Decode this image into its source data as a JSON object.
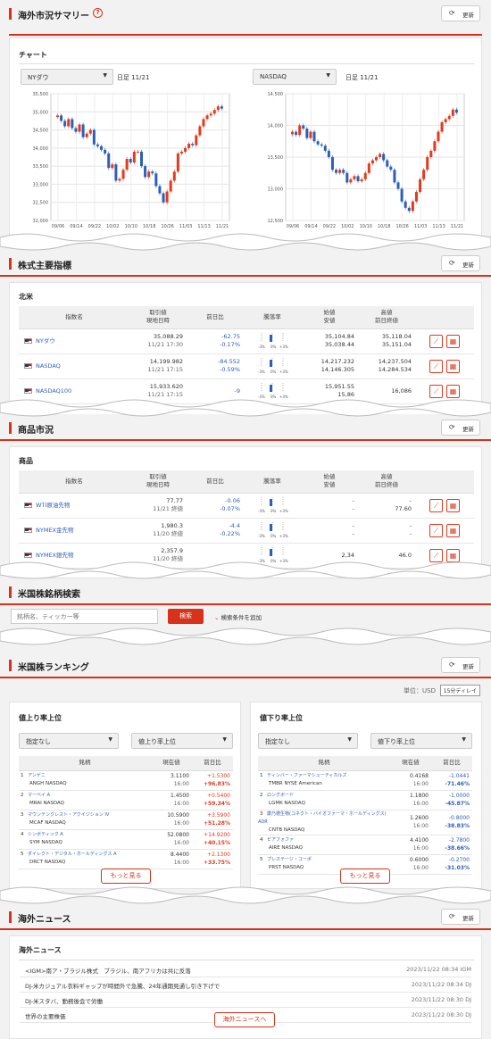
{
  "summary": {
    "title": "海外市況サマリー",
    "refresh": "更新",
    "chart_heading": "チャート",
    "charts": [
      {
        "select": "NYダウ",
        "period": "日足 11/21",
        "chart_data": {
          "type": "candlestick",
          "y_ticks": [
            "35,500",
            "35,000",
            "34,500",
            "34,000",
            "33,500",
            "33,000",
            "32,500",
            "32,000"
          ],
          "x_ticks": [
            "09/06",
            "09/14",
            "09/22",
            "10/02",
            "10/10",
            "10/18",
            "10/26",
            "11/03",
            "11/13",
            "11/21"
          ],
          "ylim": [
            32000,
            35500
          ],
          "closes": [
            34900,
            34750,
            34600,
            34800,
            34550,
            34450,
            34650,
            34300,
            34400,
            34500,
            34100,
            34050,
            33950,
            33850,
            33450,
            33550,
            33100,
            33150,
            33400,
            33700,
            33600,
            33900,
            33900,
            33500,
            33200,
            33350,
            33300,
            32950,
            32750,
            32500,
            32800,
            33100,
            33350,
            33850,
            33900,
            34000,
            34120,
            34080,
            34350,
            34600,
            34800,
            34900,
            34950,
            35050,
            35150,
            35090
          ]
        }
      },
      {
        "select": "NASDAQ",
        "period": "日足 11/21",
        "chart_data": {
          "type": "candlestick",
          "y_ticks": [
            "14,500",
            "14,000",
            "13,500",
            "13,000",
            "12,500"
          ],
          "x_ticks": [
            "09/06",
            "09/14",
            "09/22",
            "10/02",
            "10/10",
            "10/18",
            "10/26",
            "11/03",
            "11/13",
            "11/21"
          ],
          "ylim": [
            12500,
            14500
          ],
          "closes": [
            13900,
            13850,
            14000,
            13950,
            13800,
            13900,
            13750,
            13700,
            13680,
            13600,
            13500,
            13300,
            13250,
            13300,
            13250,
            13100,
            13150,
            13200,
            13120,
            13150,
            13250,
            13400,
            13450,
            13500,
            13550,
            13450,
            13350,
            13300,
            13100,
            13000,
            12800,
            12700,
            12650,
            12800,
            12950,
            13150,
            13300,
            13500,
            13600,
            13750,
            13900,
            14050,
            14100,
            14150,
            14250,
            14200
          ]
        }
      }
    ]
  },
  "indices": {
    "title": "株式主要指標",
    "refresh": "更新",
    "region": "北米",
    "headers": {
      "name": "指数名",
      "price1": "取引値",
      "price2": "現地日時",
      "chg": "前日比",
      "ratio": "騰落率",
      "open1": "始値",
      "open2": "安値",
      "high1": "高値",
      "high2": "前日終値"
    },
    "rows": [
      {
        "name": "NYダウ",
        "price": "35,088.29",
        "time": "11/21 17:30",
        "chg": "-62.75",
        "pct": "-0.17%",
        "open": "35,104.84",
        "low": "35,038.44",
        "high": "35,118.04",
        "prev": "35,151.04"
      },
      {
        "name": "NASDAQ",
        "price": "14,199.982",
        "time": "11/21 17:15",
        "chg": "-84.552",
        "pct": "-0.59%",
        "open": "14,217.232",
        "low": "14,146.305",
        "high": "14,237.504",
        "prev": "14,284.534"
      },
      {
        "name": "NASDAQ100",
        "price": "15,933.620",
        "time": "11/21 17:15",
        "chg": "-9",
        "pct": "",
        "open": "15,951.55",
        "low": "15,86",
        "high": "16,086",
        "prev": ""
      }
    ],
    "gauge": {
      "left": "-3%",
      "mid": "0%",
      "right": "+3%"
    }
  },
  "commodities": {
    "title": "商品市況",
    "refresh": "更新",
    "region": "商品",
    "rows": [
      {
        "name": "WTI原油先物",
        "price": "77.77",
        "time": "11/21 終値",
        "chg": "-0.06",
        "pct": "-0.07%",
        "open": "-",
        "low": "-",
        "high": "-",
        "prev": "77.60"
      },
      {
        "name": "NYMEX金先物",
        "price": "1,980.3",
        "time": "11/20 終値",
        "chg": "-4.4",
        "pct": "-0.22%",
        "open": "-",
        "low": "-",
        "high": "-",
        "prev": "-"
      },
      {
        "name": "NYMEX銀先物",
        "price": "2,357.9",
        "time": "11/20 終値",
        "chg": "",
        "pct": "",
        "open": "2,34",
        "low": "",
        "high": "46.0",
        "prev": ""
      }
    ]
  },
  "search": {
    "title": "米国株銘柄検索",
    "placeholder": "銘柄名、ティッカー等",
    "button": "検索",
    "add_cond": "検索条件を追加"
  },
  "ranking": {
    "title": "米国株ランキング",
    "refresh": "更新",
    "unit": "単位：USD",
    "delay": "15分ディレイ",
    "headers": {
      "name": "銘柄",
      "price": "現在値",
      "chg": "前日比"
    },
    "more": "もっと見る",
    "up": {
      "title": "値上り率上位",
      "sel1": "指定なし",
      "sel2": "値上り率上位",
      "rows": [
        {
          "n": "1",
          "jp": "アンゲニ",
          "en": "ANGH NASDAQ",
          "price": "3.1100",
          "time": "16:00",
          "chg": "+1.5300",
          "pct": "+96.83%"
        },
        {
          "n": "2",
          "jp": "マーベイ A",
          "en": "MRAI NASDAQ",
          "price": "1.4500",
          "time": "16:00",
          "chg": "+0.5400",
          "pct": "+59.34%"
        },
        {
          "n": "3",
          "jp": "マウンテンクレスト・アクイジション IV",
          "en": "MCAF NASDAQ",
          "price": "10.5900",
          "time": "16:00",
          "chg": "+3.5900",
          "pct": "+51.28%"
        },
        {
          "n": "4",
          "jp": "シンボティック A",
          "en": "SYM NASDAQ",
          "price": "52.0800",
          "time": "16:00",
          "chg": "+14.9200",
          "pct": "+40.15%"
        },
        {
          "n": "5",
          "jp": "ダイレクト・デジタル・ホールディングス A",
          "en": "DRCT NASDAQ",
          "price": "8.4400",
          "time": "16:00",
          "chg": "+2.1300",
          "pct": "+33.75%"
        }
      ]
    },
    "down": {
      "title": "値下り率上位",
      "sel1": "指定なし",
      "sel2": "値下り率上位",
      "rows": [
        {
          "n": "1",
          "jp": "ティンバー・ファーマシューティカルズ",
          "en": "TMBR NYSE American",
          "price": "0.4168",
          "time": "16:00",
          "chg": "-1.0441",
          "pct": "-71.46%"
        },
        {
          "n": "2",
          "jp": "ロングボード",
          "en": "LGMK NASDAQ",
          "price": "1.1800",
          "time": "16:00",
          "chg": "-1.0000",
          "pct": "-45.87%"
        },
        {
          "n": "3",
          "jp": "康乃德生物(コネクト・バイオファーマ・ホールディングス) ADR",
          "en": "CNTB NASDAQ",
          "price": "1.2600",
          "time": "16:00",
          "chg": "-0.8000",
          "pct": "-38.83%"
        },
        {
          "n": "4",
          "jp": "ビアフォファ",
          "en": "AIRE NASDAQ",
          "price": "4.4100",
          "time": "16:00",
          "chg": "-2.7800",
          "pct": "-38.66%"
        },
        {
          "n": "5",
          "jp": "プレステージ・コーポ",
          "en": "PRST NASDAQ",
          "price": "0.6000",
          "time": "16:00",
          "chg": "-0.2700",
          "pct": "-31.03%"
        }
      ]
    }
  },
  "news": {
    "title": "海外ニュース",
    "refresh": "更新",
    "heading": "海外ニュース",
    "items": [
      {
        "t": "<IGM>南ア・ブラジル株式　ブラジル、南アフリカは共に反落",
        "d": "2023/11/22 08:34 IGM"
      },
      {
        "t": "DJ-米カジュアル衣料ギャップが時間外で急騰、24年通期見通し引き下げで",
        "d": "2023/11/22 08:34 DJ"
      },
      {
        "t": "DJ-米スタバ、勤務後会で労働",
        "d": "2023/11/22 08:30 DJ"
      },
      {
        "t": "世界の主要株価",
        "d": "2023/11/22 08:30 DJ"
      }
    ],
    "more": "海外ニュースへ"
  }
}
